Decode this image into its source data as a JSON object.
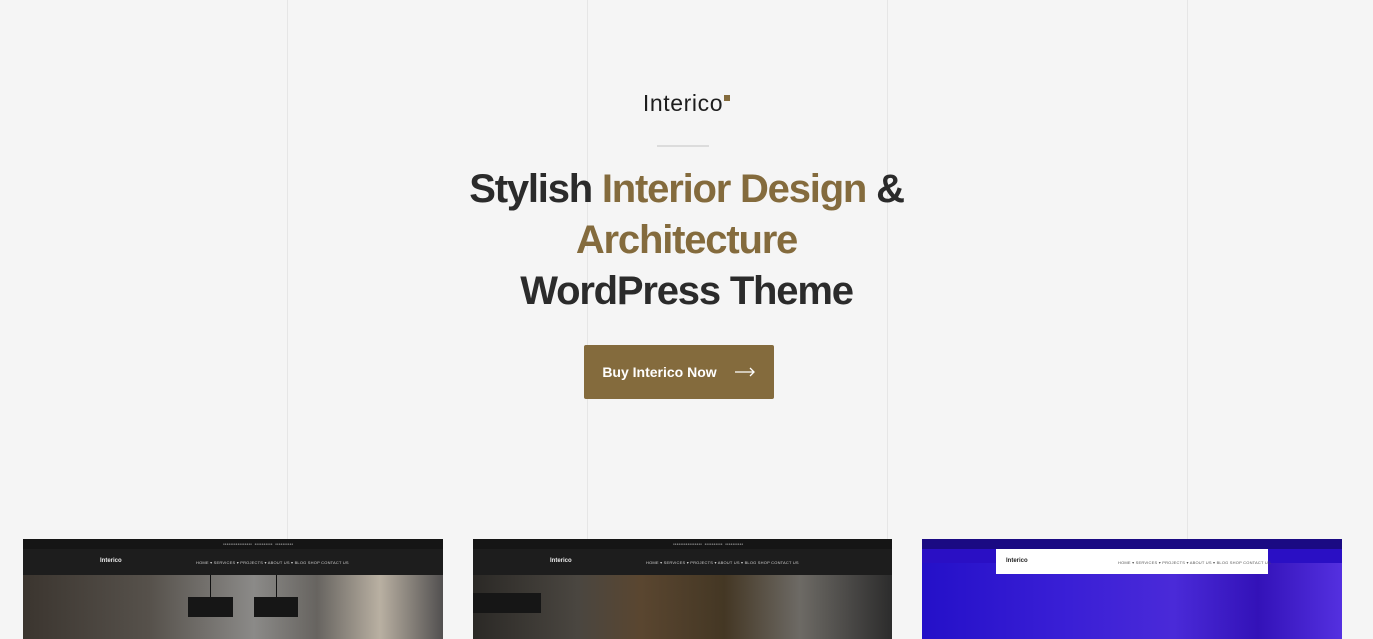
{
  "brand": {
    "name": "Interico",
    "accent": "#846b3d"
  },
  "hero": {
    "headline_part1": "Stylish ",
    "headline_accent1": "Interior Design",
    "headline_part2": " &",
    "headline_accent2": "Architecture",
    "headline_line3": "WordPress Theme",
    "cta_label": "Buy Interico Now",
    "cta_icon": "arrow-right-icon"
  },
  "previews": [
    {
      "logo": "Interico",
      "nav": "HOME ▾ SERVICES ▾ PROJECTS ▾ ABOUT US ▾ BLOG SHOP CONTACT US"
    },
    {
      "logo": "Interico",
      "nav": "HOME ▾ SERVICES ▾ PROJECTS ▾ ABOUT US ▾ BLOG SHOP CONTACT US"
    },
    {
      "logo": "Interico",
      "nav": "HOME ▾ SERVICES ▾ PROJECTS ▾ ABOUT US ▾ BLOG SHOP CONTACT US"
    }
  ]
}
